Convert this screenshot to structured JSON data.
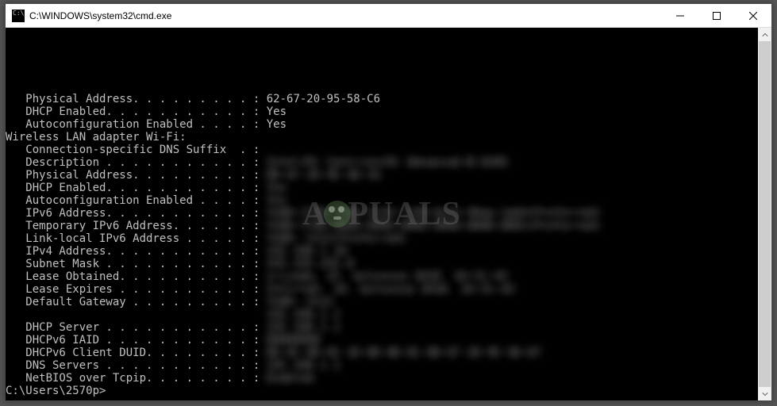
{
  "window": {
    "title": "C:\\WINDOWS\\system32\\cmd.exe"
  },
  "watermark": {
    "prefix": "A",
    "suffix": "PUALS"
  },
  "output": {
    "top": [
      {
        "label": "   Physical Address. . . . . . . . . : ",
        "value": "62-67-20-95-58-C6",
        "blur": false
      },
      {
        "label": "   DHCP Enabled. . . . . . . . . . . : ",
        "value": "Yes",
        "blur": false
      },
      {
        "label": "   Autoconfiguration Enabled . . . . : ",
        "value": "Yes",
        "blur": false
      }
    ],
    "section_header": "Wireless LAN adapter Wi-Fi:",
    "wifi": [
      {
        "label": "   Connection-specific DNS Suffix  . : ",
        "value": "",
        "blur": false
      },
      {
        "label": "   Description . . . . . . . . . . . : ",
        "value": "Intel(R) Centrino(R) Advanced-N 6205",
        "blur": true
      },
      {
        "label": "   Physical Address. . . . . . . . . : ",
        "value": "08-67-20-95-58-C6",
        "blur": true
      },
      {
        "label": "   DHCP Enabled. . . . . . . . . . . : ",
        "value": "Yes",
        "blur": true
      },
      {
        "label": "   Autoconfiguration Enabled . . . . : ",
        "value": "Yes",
        "blur": true
      },
      {
        "label": "   IPv6 Address. . . . . . . . . . . : ",
        "value": "fe80:1700:7300:3120:7140:be15:40aa:1ab4(Preferred)",
        "blur": true
      },
      {
        "label": "   Temporary IPv6 Address. . . . . . : ",
        "value": "fe80:1700:0000:0000:0000:0000:0000:0001(Preferred)",
        "blur": true
      },
      {
        "label": "   Link-local IPv6 Address . . . . . : ",
        "value": "fe80::1%12(Preferred)",
        "blur": true
      },
      {
        "label": "   IPv4 Address. . . . . . . . . . . : ",
        "value": "192.168.1.10",
        "blur": true
      },
      {
        "label": "   Subnet Mask . . . . . . . . . . . : ",
        "value": "255.255.255.0",
        "blur": true
      },
      {
        "label": "   Lease Obtained. . . . . . . . . . : ",
        "value": "srijeda, 15. kolovoza 2018. 10:51:43",
        "blur": true
      },
      {
        "label": "   Lease Expires . . . . . . . . . . : ",
        "value": "četvrtak, 16. kolovoza 2018. 10:51:43",
        "blur": true
      },
      {
        "label": "   Default Gateway . . . . . . . . . : ",
        "value": "fe80::1%12",
        "blur": true
      },
      {
        "label": "                                       ",
        "value": "192.168.1.1",
        "blur": true
      },
      {
        "label": "   DHCP Server . . . . . . . . . . . : ",
        "value": "192.168.1.1",
        "blur": true
      },
      {
        "label": "   DHCPv6 IAID . . . . . . . . . . . : ",
        "value": "00000000",
        "blur": true
      },
      {
        "label": "   DHCPv6 Client DUID. . . . . . . . : ",
        "value": "00-01-00-01-10-00-00-01-08-67-20-95-58-67",
        "blur": true
      },
      {
        "label": "   DNS Servers . . . . . . . . . . . : ",
        "value": "192.168.1.1",
        "blur": true
      },
      {
        "label": "   NetBIOS over Tcpip. . . . . . . . : ",
        "value": "Enabled",
        "blur": true
      }
    ],
    "prompt": "C:\\Users\\2570p>"
  }
}
